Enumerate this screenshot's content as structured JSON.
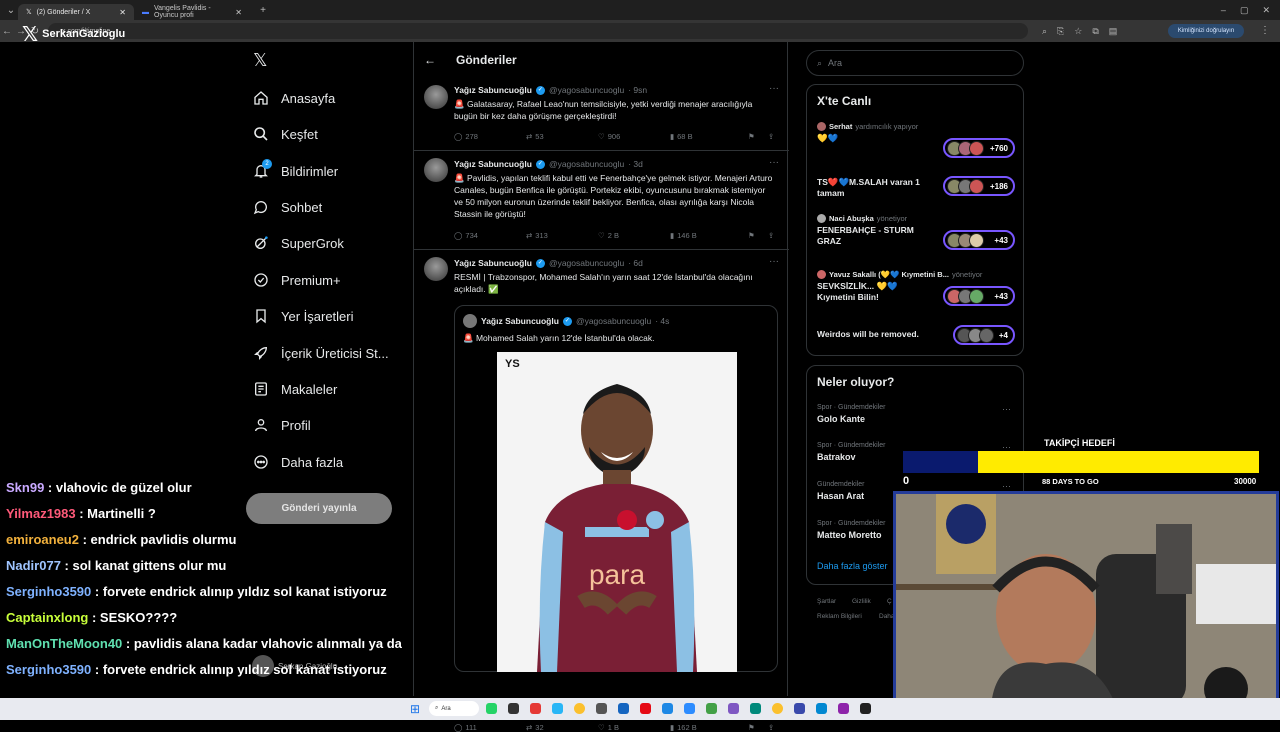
{
  "browser": {
    "tabs": [
      {
        "label": "(2) Gönderiler / X",
        "active": true
      },
      {
        "label": "Vangelis Pavlidis - Oyuncu profi",
        "active": false
      }
    ],
    "url": "x.com/i/timeline",
    "verify_label": "Kimliğinizi doğrulayın"
  },
  "overlay_brand": {
    "logo": "𝕏",
    "name": "SerkanGazioglu"
  },
  "nav": {
    "logo": "𝕏",
    "items": [
      {
        "label": "Anasayfa",
        "icon": "home-icon"
      },
      {
        "label": "Keşfet",
        "icon": "search-icon"
      },
      {
        "label": "Bildirimler",
        "icon": "bell-icon",
        "badge": "2"
      },
      {
        "label": "Sohbet",
        "icon": "chat-icon"
      },
      {
        "label": "SuperGrok",
        "icon": "grok-icon"
      },
      {
        "label": "Premium+",
        "icon": "premium-icon"
      },
      {
        "label": "Yer İşaretleri",
        "icon": "bookmark-icon"
      },
      {
        "label": "İçerik Üreticisi St...",
        "icon": "rocket-icon"
      },
      {
        "label": "Makaleler",
        "icon": "article-icon"
      },
      {
        "label": "Profil",
        "icon": "user-icon"
      },
      {
        "label": "Daha fazla",
        "icon": "more-icon"
      }
    ],
    "post_button": "Gönderi yayınla"
  },
  "feed": {
    "title": "Gönderiler",
    "tweets": [
      {
        "name": "Yağız Sabuncuoğlu",
        "handle": "@yagosabuncuoglu",
        "time": "· 9sn",
        "body": "🚨 Galatasaray, Rafael Leao'nun temsilcisiyle, yetki verdiği menajer aracılığıyla bugün bir kez daha görüşme gerçekleştirdi!",
        "replies": "278",
        "retweets": "53",
        "likes": "906",
        "views": "68 B"
      },
      {
        "name": "Yağız Sabuncuoğlu",
        "handle": "@yagosabuncuoglu",
        "time": "· 3d",
        "body": "🚨 Pavlidis, yapılan teklifi kabul etti ve Fenerbahçe'ye gelmek istiyor. Menajeri Arturo Canales, bugün Benfica ile görüştü. Portekiz ekibi, oyuncusunu bırakmak istemiyor ve 50 milyon euronun üzerinde teklif bekliyor. Benfica, olası ayrılığa karşı Nicola Stassin ile görüştü!",
        "replies": "734",
        "retweets": "313",
        "likes": "2 B",
        "views": "146 B"
      },
      {
        "name": "Yağız Sabuncuoğlu",
        "handle": "@yagosabuncuoglu",
        "time": "· 6d",
        "body": "RESMİ | Trabzonspor, Mohamed Salah'ın yarın saat 12'de İstanbul'da olacağını açıkladı. ✅",
        "quote": {
          "name": "Yağız Sabuncuoğlu",
          "handle": "@yagosabuncuoglu",
          "time": "· 4s",
          "body": "🚨 Mohamed Salah yarın 12'de İstanbul'da olacak.",
          "photo_mark": "YS",
          "shirt_sponsor": "para"
        },
        "replies": "111",
        "retweets": "32",
        "likes": "1 B",
        "views": "162 B"
      }
    ]
  },
  "sidebar": {
    "search_placeholder": "Ara",
    "live_title": "X'te Canlı",
    "live": [
      {
        "host": "Serhat",
        "role": "yardımcılık yapıyor",
        "title": "💛💙",
        "count": "+760"
      },
      {
        "host": "",
        "role": "",
        "title": "TS❤️💙M.SALAH  varan 1 tamam",
        "count": "+186"
      },
      {
        "host": "Naci Abuşka",
        "role": "yönetiyor",
        "title": "FENERBAHÇE - STURM GRAZ",
        "count": "+43"
      },
      {
        "host": "Yavuz Sakallı (💛💙 Kıymetini B...",
        "role": "yönetiyor",
        "title": "SEVKSİZLİK... 💛💙 Kıymetini Bilin!",
        "count": "+43"
      },
      {
        "host": "",
        "role": "",
        "title": "Weirdos will be removed.",
        "count": "+4"
      }
    ],
    "trends_title": "Neler oluyor?",
    "trends": [
      {
        "category": "Spor · Gündemdekiler",
        "name": "Golo Kante"
      },
      {
        "category": "Spor · Gündemdekiler",
        "name": "Batrakov"
      },
      {
        "category": "Gündemdekiler",
        "name": "Hasan Arat"
      },
      {
        "category": "Spor · Gündemdekiler",
        "name": "Matteo Moretto"
      }
    ],
    "show_more": "Daha fazla göster",
    "footer": [
      "Şartlar",
      "Gizlilik",
      "Ç",
      "Reklam Bilgileri",
      "Daha"
    ]
  },
  "goal": {
    "title": "TAKİPÇİ HEDEFİ",
    "min": "0",
    "max": "30000",
    "days": "88 DAYS TO GO",
    "progress": 0.21,
    "fill_color": "#0a1a6e",
    "bar_color": "#ffeb00"
  },
  "chat": [
    {
      "user": "Skn99",
      "color": "#c9a9ff",
      "msg": " : vlahovic de güzel olur"
    },
    {
      "user": "Yilmaz1983",
      "color": "#ff5a7a",
      "msg": " : Martinelli ?"
    },
    {
      "user": "emiroaneu2",
      "color": "#f2b13c",
      "msg": " : endrick pavlidis olurmu"
    },
    {
      "user": "Nadir077",
      "color": "#9fc4ff",
      "msg": " : sol kanat gittens olur mu"
    },
    {
      "user": "Serginho3590",
      "color": "#7fb2ff",
      "msg": " : forvete endrick alınıp yıldız sol kanat istiyoruz"
    },
    {
      "user": "Captainxlong",
      "color": "#c8ff3a",
      "msg": " : SESKO????"
    },
    {
      "user": "ManOnTheMoon40",
      "color": "#5fe0b0",
      "msg": " : pavlidis alana kadar vlahovic alınmalı ya da"
    },
    {
      "user": "Serginho3590",
      "color": "#7fb2ff",
      "msg": " : forvete endrick alınıp yıldız sol kanat istiyoruz"
    }
  ],
  "streamer_tag": "Serkan Gazioğlu",
  "taskbar": {
    "search_label": "Ara"
  }
}
